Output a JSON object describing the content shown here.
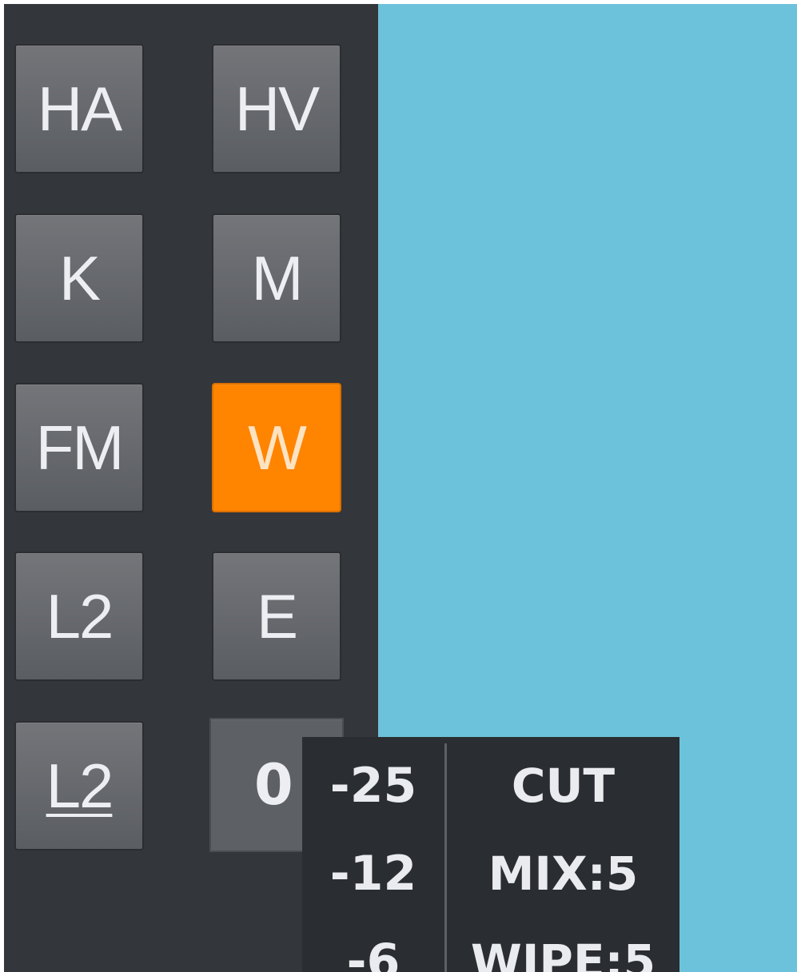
{
  "buttons": {
    "ha": "HA",
    "hv": "HV",
    "k": "K",
    "m": "M",
    "fm": "FM",
    "w": "W",
    "l2": "L2",
    "e": "E",
    "l2_underlined": "L2",
    "counter_value": "0"
  },
  "active_button": "W",
  "colors": {
    "panel": "#33363b",
    "button": "#63666b",
    "active": "#ff8400",
    "preview": "#6cc2da",
    "popup": "#2a2d31"
  },
  "popup": {
    "levels": [
      "-25",
      "-12",
      "-6"
    ],
    "transitions": [
      "CUT",
      "MIX:5",
      "WIPE:5"
    ]
  }
}
